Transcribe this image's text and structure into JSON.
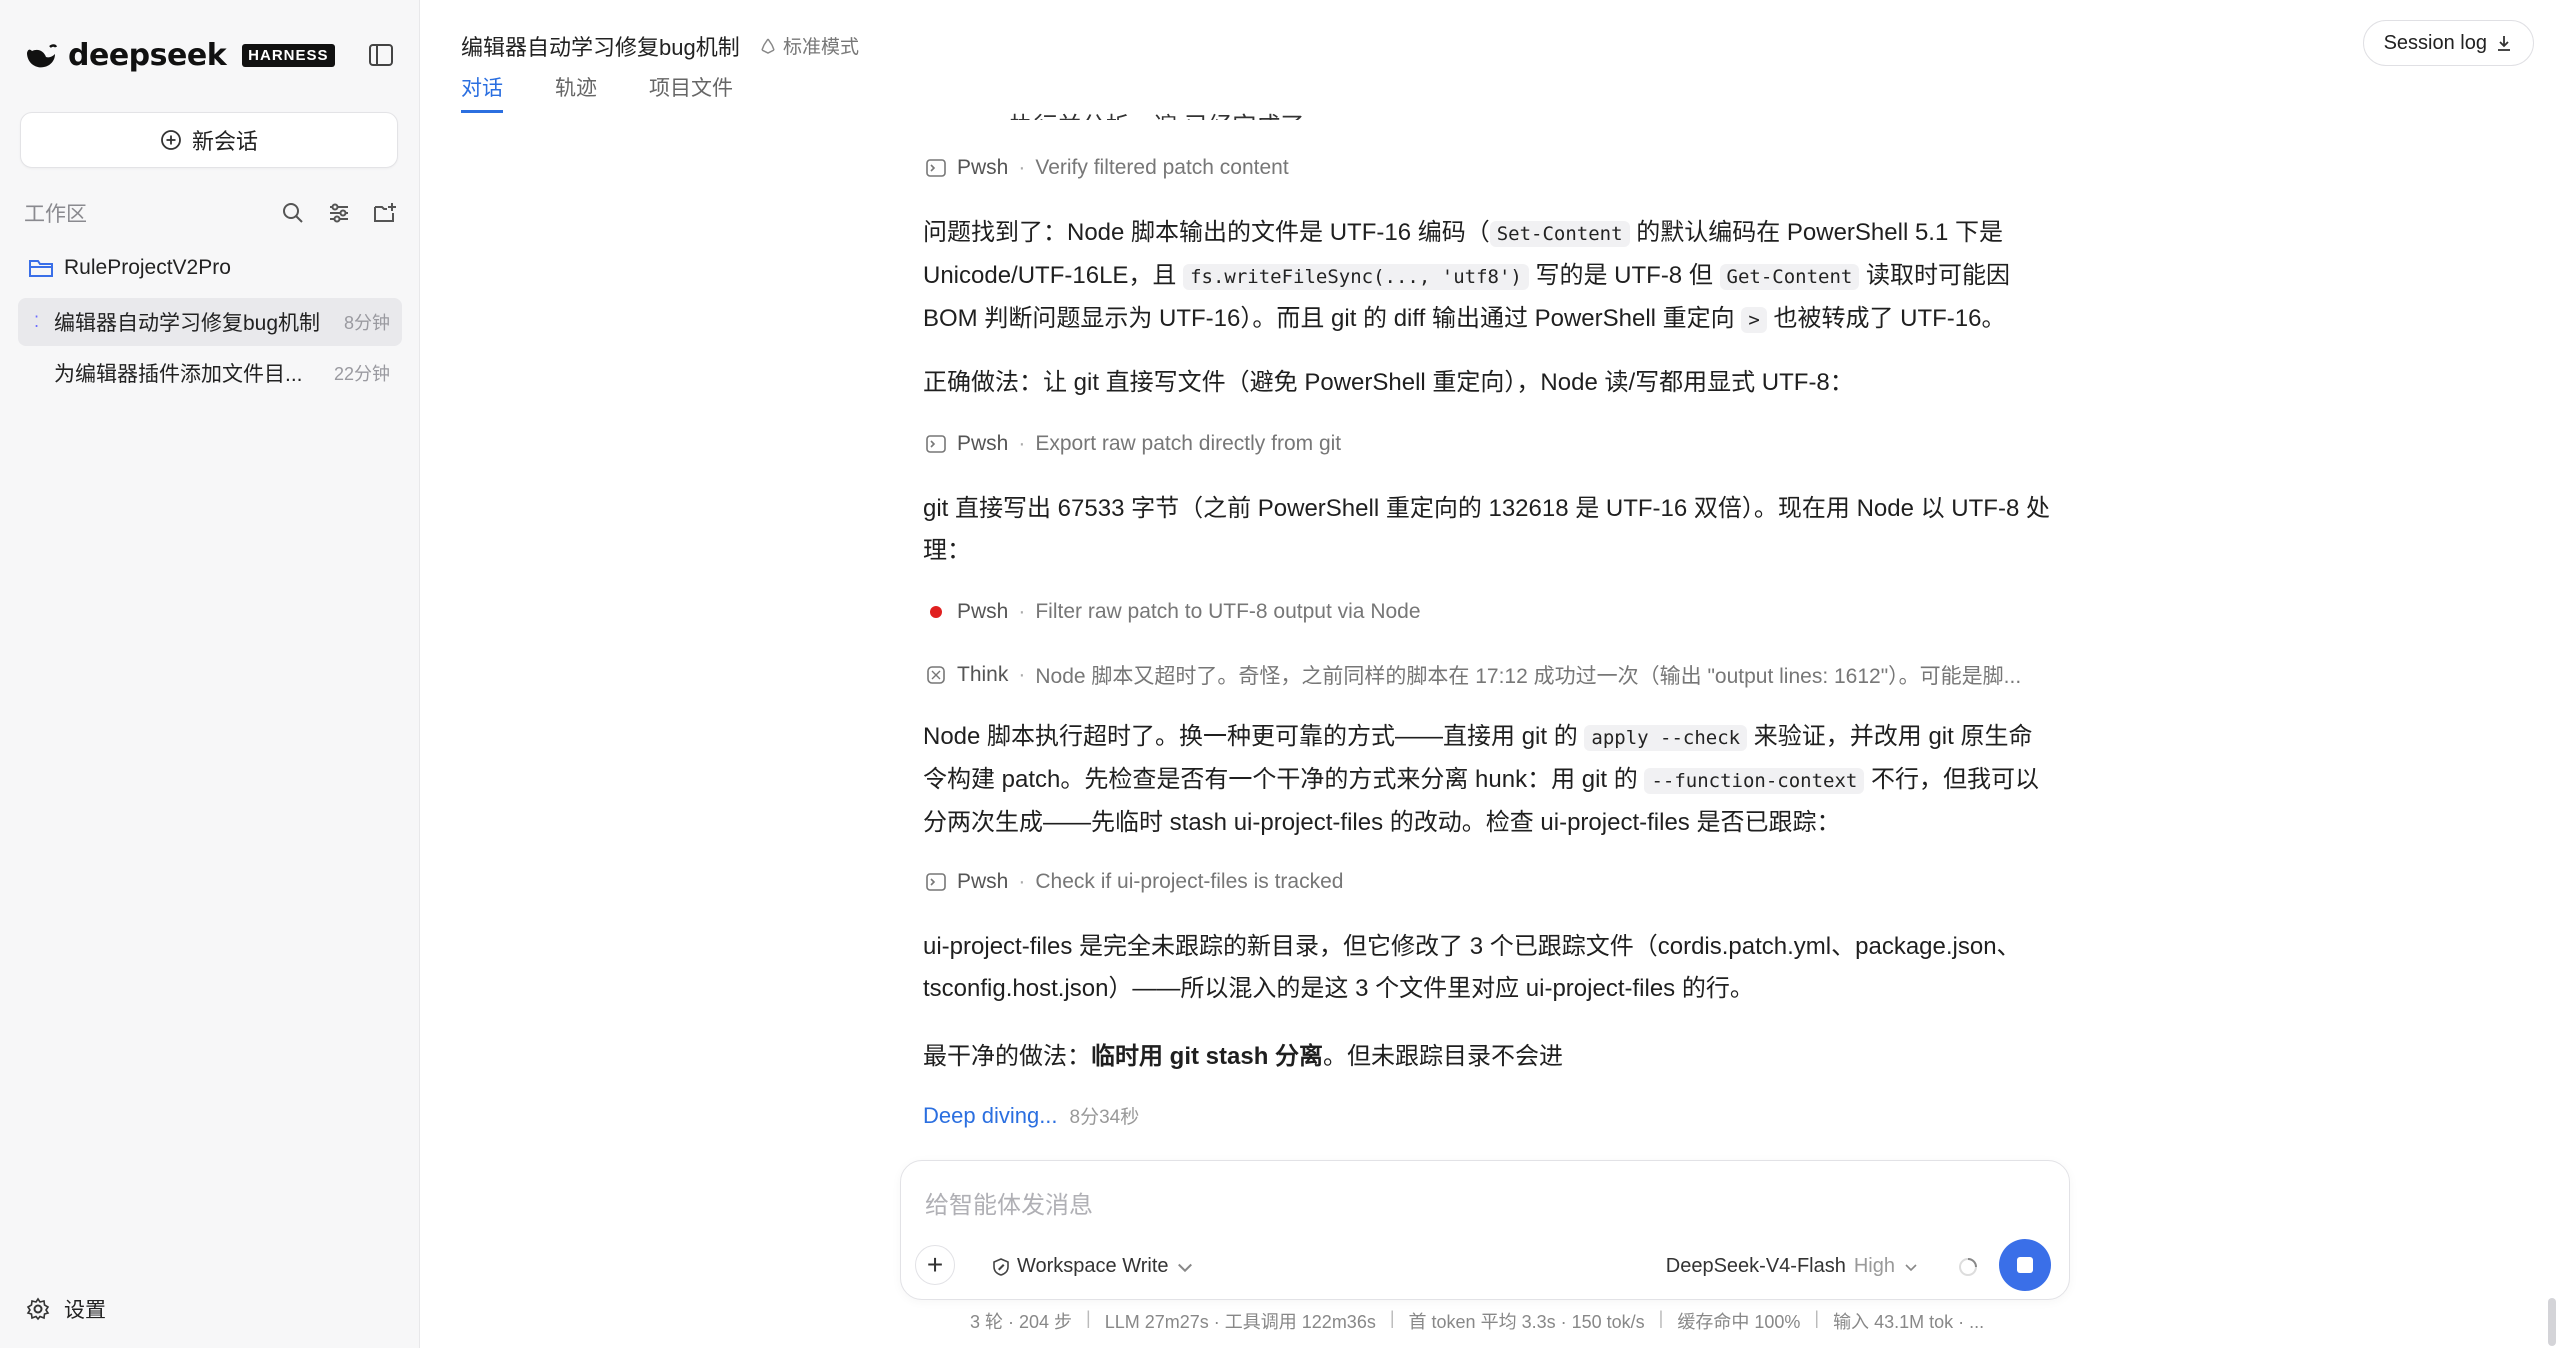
{
  "sidebar": {
    "brand_name": "deepseek",
    "brand_badge": "HARNESS",
    "new_chat_label": "新会话",
    "workspace_label": "工作区",
    "project_name": "RuleProjectV2Pro",
    "sessions": [
      {
        "title": "编辑器自动学习修复bug机制",
        "time": "8分钟"
      },
      {
        "title": "为编辑器插件添加文件目...",
        "time": "22分钟"
      }
    ],
    "settings_label": "设置"
  },
  "topbar": {
    "title": "编辑器自动学习修复bug机制",
    "mode": "标准模式",
    "tabs": [
      {
        "label": "对话"
      },
      {
        "label": "轨迹"
      },
      {
        "label": "项目文件"
      }
    ],
    "session_log_label": "Session log"
  },
  "conversation": {
    "cut_line": "... 执行并分析一遍 已经完成了",
    "tool1": {
      "kind": "Pwsh",
      "desc": "Verify filtered patch content"
    },
    "p1": {
      "t1": "问题找到了：Node 脚本输出的文件是 UTF-16 编码（",
      "c1": "Set-Content",
      "t2": " 的默认编码在 PowerShell 5.1 下是 Unicode/UTF-16LE，且 ",
      "c2": "fs.writeFileSync(..., 'utf8')",
      "t3": " 写的是 UTF-8 但 ",
      "c3": "Get-Content",
      "t4": " 读取时可能因 BOM 判断问题显示为 UTF-16）。而且 git 的 diff 输出通过 PowerShell 重定向 ",
      "c4": ">",
      "t5": " 也被转成了 UTF-16。"
    },
    "p2": "正确做法：让 git 直接写文件（避免 PowerShell 重定向），Node 读/写都用显式 UTF-8：",
    "tool2": {
      "kind": "Pwsh",
      "desc": "Export raw patch directly from git"
    },
    "p3": "git 直接写出 67533 字节（之前 PowerShell 重定向的 132618 是 UTF-16 双倍）。现在用 Node 以 UTF-8 处理：",
    "tool3": {
      "kind": "Pwsh",
      "desc": "Filter raw patch to UTF-8 output via Node"
    },
    "think": {
      "kind": "Think",
      "desc": "Node 脚本又超时了。奇怪，之前同样的脚本在 17:12 成功过一次（输出 \"output lines: 1612\"）。可能是脚..."
    },
    "p4": {
      "t1": "Node 脚本执行超时了。换一种更可靠的方式——直接用 git 的 ",
      "c1": "apply --check",
      "t2": " 来验证，并改用 git 原生命令构建 patch。先检查是否有一个干净的方式来分离 hunk：用 git 的 ",
      "c2": "--function-context",
      "t3": " 不行，但我可以分两次生成——先临时 stash ui-project-files 的改动。检查 ui-project-files 是否已跟踪："
    },
    "tool4": {
      "kind": "Pwsh",
      "desc": "Check if ui-project-files is tracked"
    },
    "p5": "ui-project-files 是完全未跟踪的新目录，但它修改了 3 个已跟踪文件（cordis.patch.yml、package.json、tsconfig.host.json）——所以混入的是这 3 个文件里对应 ui-project-files 的行。",
    "p6": {
      "t1": "最干净的做法：",
      "b1": "临时用 git stash 分离",
      "t2": "。但未跟踪目录不会进"
    },
    "deep_label": "Deep diving...",
    "deep_time": "8分34秒"
  },
  "composer": {
    "placeholder": "给智能体发消息",
    "workspace_write": "Workspace Write",
    "model": "DeepSeek-V4-Flash",
    "level": "High"
  },
  "stats": [
    "3 轮 · 204 步",
    "LLM 27m27s · 工具调用 122m36s",
    "首 token 平均 3.3s · 150 tok/s",
    "缓存命中 100%",
    "输入 43.1M tok · ..."
  ]
}
